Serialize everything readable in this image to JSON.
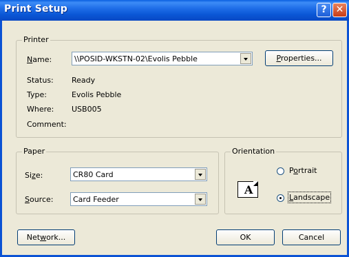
{
  "window": {
    "title": "Print Setup",
    "help_icon": "question-mark-icon",
    "close_icon": "close-x-icon"
  },
  "printer": {
    "group_label": "Printer",
    "name_label_pre": "",
    "name_label_u": "N",
    "name_label_post": "ame:",
    "name_value": "\\\\POSID-WKSTN-02\\Evolis Pebble",
    "properties_u": "P",
    "properties_rest": "roperties...",
    "status_label": "Status:",
    "status_value": "Ready",
    "type_label": "Type:",
    "type_value": "Evolis Pebble",
    "where_label": "Where:",
    "where_value": "USB005",
    "comment_label": "Comment:",
    "comment_value": ""
  },
  "paper": {
    "group_label": "Paper",
    "size_label_pre": "Si",
    "size_label_u": "z",
    "size_label_post": "e:",
    "size_value": "CR80 Card",
    "source_label_u": "S",
    "source_label_post": "ource:",
    "source_value": "Card Feeder"
  },
  "orientation": {
    "group_label": "Orientation",
    "portrait_pre": "P",
    "portrait_u": "o",
    "portrait_post": "rtrait",
    "landscape_u": "L",
    "landscape_post": "andscape",
    "selected": "Landscape",
    "icon_letter": "A"
  },
  "buttons": {
    "network_pre": "Net",
    "network_u": "w",
    "network_post": "ork...",
    "ok": "OK",
    "cancel": "Cancel"
  },
  "colors": {
    "titlebar": "#0a5fe0",
    "dialog_bg": "#ece9d8",
    "close_button": "#c83c16"
  }
}
